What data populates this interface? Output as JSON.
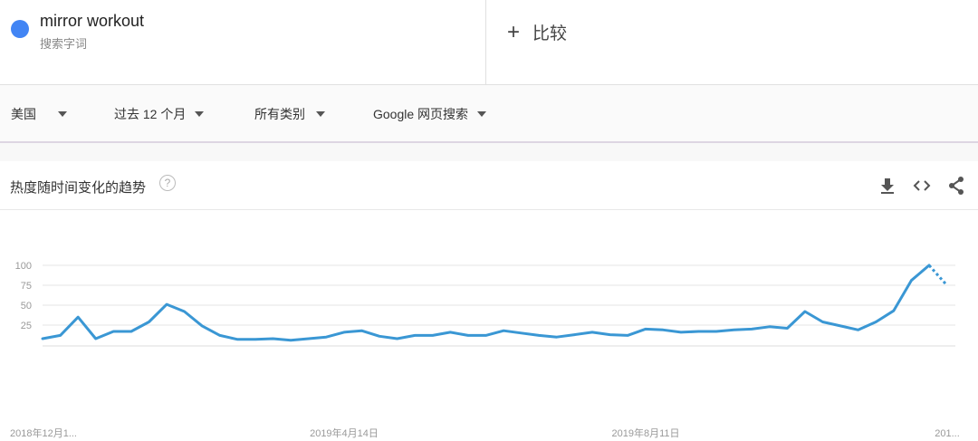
{
  "term": {
    "name": "mirror workout",
    "type_label": "搜索字词",
    "color": "#4285f4"
  },
  "compare": {
    "label": "比较",
    "icon": "plus-icon"
  },
  "filters": [
    {
      "name": "region",
      "label": "美国"
    },
    {
      "name": "time-range",
      "label": "过去 12 个月"
    },
    {
      "name": "category",
      "label": "所有类别"
    },
    {
      "name": "search-type",
      "label": "Google 网页搜索"
    }
  ],
  "card": {
    "title": "热度随时间变化的趋势",
    "help_glyph": "?",
    "tools": [
      "download-icon",
      "embed-icon",
      "share-icon"
    ]
  },
  "colors": {
    "line": "#3a97d4",
    "grid": "#e6e6e6",
    "axis_text": "#999999"
  },
  "chart_data": {
    "type": "line",
    "title": "",
    "xlabel": "",
    "ylabel": "",
    "ylim": [
      0,
      100
    ],
    "y_ticks": [
      "25",
      "50",
      "75",
      "100"
    ],
    "x_tick_labels": [
      "2018年12月1...",
      "2019年4月14日",
      "2019年8月11日",
      "201..."
    ],
    "grid": true,
    "series": [
      {
        "values": [
          8,
          12,
          35,
          8,
          17,
          17,
          29,
          51,
          42,
          24,
          12,
          7,
          7,
          8,
          6,
          8,
          10,
          16,
          18,
          11,
          8,
          12,
          12,
          16,
          12,
          12,
          18,
          15,
          12,
          10,
          13,
          16,
          13,
          12,
          20,
          19,
          16,
          17,
          17,
          19,
          20,
          23,
          21,
          42,
          29,
          24,
          19,
          29,
          43,
          81,
          100
        ],
        "partial_values": [
          100,
          75
        ]
      }
    ]
  }
}
